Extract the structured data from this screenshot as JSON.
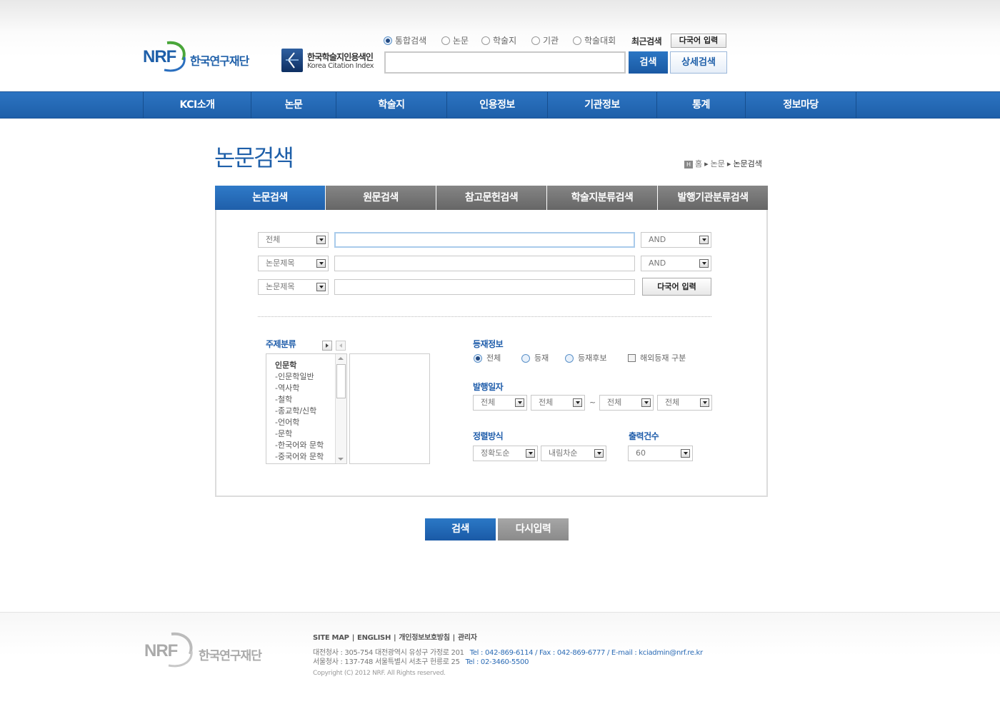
{
  "header": {
    "nrf_logo_text": "NRF",
    "nrf_name": "한국연구재단",
    "kci_name": "한국학술지인용색인",
    "kci_sub": "Korea Citation Index",
    "search_scopes": [
      "통합검색",
      "논문",
      "학술지",
      "기관",
      "학술대회"
    ],
    "recent_search_label": "최근검색",
    "multilang_button": "다국어 입력",
    "search_button": "검색",
    "advanced_button": "상세검색"
  },
  "gnb": [
    "KCI소개",
    "논문",
    "학술지",
    "인용정보",
    "기관정보",
    "통계",
    "정보마당"
  ],
  "page": {
    "title": "논문검색",
    "breadcrumb_home_icon": "H",
    "breadcrumb": [
      "홈",
      "논문",
      "논문검색"
    ]
  },
  "tabs": [
    "논문검색",
    "원문검색",
    "참고문헌검색",
    "학술지분류검색",
    "발행기관분류검색"
  ],
  "search_form": {
    "rows": [
      {
        "field": "전체",
        "op": "AND"
      },
      {
        "field": "논문제목",
        "op": "AND"
      },
      {
        "field": "논문제목"
      }
    ],
    "multilang_button": "다국어 입력"
  },
  "subject": {
    "label": "주제분류",
    "items": [
      "인문학",
      "-인문학일반",
      "-역사학",
      "-철학",
      "-종교학/신학",
      "-언어학",
      "-문학",
      "-한국어와 문학",
      "-중국어와 문학"
    ]
  },
  "registration": {
    "label": "등재정보",
    "options": [
      "전체",
      "등재",
      "등재후보"
    ],
    "overseas_label": "해외등재 구분"
  },
  "publish_date": {
    "label": "발행일자",
    "selects": [
      "전체",
      "전체",
      "전체",
      "전체"
    ],
    "separator": "~"
  },
  "sort": {
    "label": "정렬방식",
    "selects": [
      "정확도순",
      "내림차순"
    ]
  },
  "output": {
    "label": "출력건수",
    "value": "60"
  },
  "actions": {
    "search": "검색",
    "reset": "다시입력"
  },
  "footer": {
    "logo_text": "NRF",
    "org_name": "한국연구재단",
    "links": [
      "SITE MAP",
      "ENGLISH",
      "개인정보보호방침",
      "관리자"
    ],
    "daejeon": "대전청사 : 305-754 대전광역시 유성구 가정로 201",
    "daejeon_contact": "Tel : 042-869-6114 /  Fax : 042-869-6777 /  E-mail : kciadmin@nrf.re.kr",
    "seoul": "서울청사 : 137-748 서울특별시 서초구 헌릉로 25",
    "seoul_contact": "Tel : 02-3460-5500",
    "copyright": "Copyright (C) 2012 NRF. All Rights reserved."
  },
  "colors": {
    "primary_blue": "#1e5fa9",
    "tab_gray": "#777777",
    "accent_blue": "#1e5caa"
  }
}
